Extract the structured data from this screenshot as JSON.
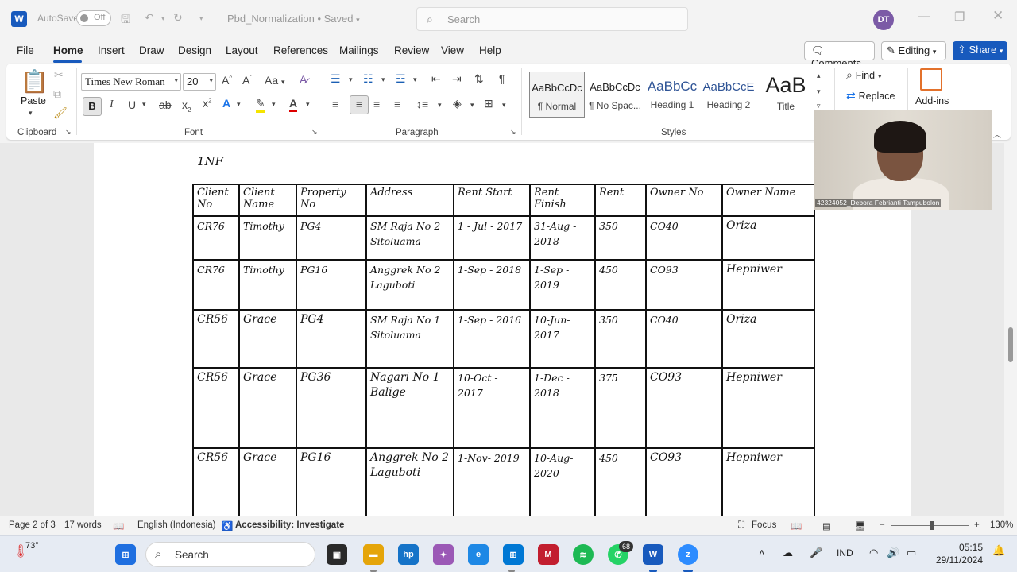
{
  "titlebar": {
    "app_icon": "W",
    "autosave_label": "AutoSave",
    "autosave_state": "Off",
    "doc_name": "Pbd_Normalization • Saved",
    "search_placeholder": "Search",
    "avatar_initials": "DT"
  },
  "menu": {
    "items": [
      "File",
      "Home",
      "Insert",
      "Draw",
      "Design",
      "Layout",
      "References",
      "Mailings",
      "Review",
      "View",
      "Help"
    ],
    "active": "Home",
    "comments": "Comments",
    "editing": "Editing",
    "share": "Share"
  },
  "ribbon": {
    "clipboard": {
      "paste": "Paste",
      "label": "Clipboard"
    },
    "font": {
      "family": "Times New Roman",
      "size": "20",
      "label": "Font",
      "case_label": "Aa"
    },
    "paragraph": {
      "label": "Paragraph"
    },
    "styles": {
      "label": "Styles",
      "items": [
        {
          "preview": "AaBbCcDc",
          "name": "¶ Normal"
        },
        {
          "preview": "AaBbCcDc",
          "name": "¶ No Spac..."
        },
        {
          "preview": "AaBbCc",
          "name": "Heading 1"
        },
        {
          "preview": "AaBbCcE",
          "name": "Heading 2"
        },
        {
          "preview": "AaB",
          "name": "Title"
        }
      ]
    },
    "editing": {
      "find": "Find",
      "replace": "Replace"
    },
    "addins": {
      "label": "Add-ins"
    }
  },
  "document": {
    "heading": "1NF",
    "table": {
      "headers": [
        "Client No",
        "Client Name",
        "Property No",
        "Address",
        "Rent Start",
        "Rent Finish",
        "Rent",
        "Owner No",
        "Owner Name"
      ],
      "rows": [
        [
          "CR76",
          "Timothy",
          "PG4",
          "SM Raja No 2 Sitoluama",
          "1 - Jul - 2017",
          "31-Aug - 2018",
          "350",
          "CO40",
          "Oriza"
        ],
        [
          "CR76",
          "Timothy",
          "PG16",
          "Anggrek No 2 Laguboti",
          "1-Sep - 2018",
          "1-Sep - 2019",
          "450",
          "CO93",
          "Hepniwer"
        ],
        [
          "CR56",
          "Grace",
          "PG4",
          "SM Raja No 1 Sitoluama",
          "1-Sep - 2016",
          "10-Jun-2017",
          "350",
          "CO40",
          "Oriza"
        ],
        [
          "CR56",
          "Grace",
          "PG36",
          "Nagari No 1 Balige",
          "10-Oct - 2017",
          "1-Dec - 2018",
          "375",
          "CO93",
          "Hepniwer"
        ],
        [
          "CR56",
          "Grace",
          "PG16",
          "Anggrek No 2 Laguboti",
          "1-Nov- 2019",
          "10-Aug- 2020",
          "450",
          "CO93",
          "Hepniwer"
        ]
      ]
    }
  },
  "video": {
    "caption": "42324052_Debora Febrianti Tampubolon"
  },
  "status": {
    "page": "Page 2 of 3",
    "words": "17 words",
    "language": "English (Indonesia)",
    "accessibility": "Accessibility: Investigate",
    "focus": "Focus",
    "zoom": "130%"
  },
  "taskbar": {
    "weather": "73°",
    "search_placeholder": "Search",
    "whatsapp_badge": "68",
    "lang": "IND",
    "time": "05:15",
    "date": "29/11/2024"
  },
  "colors": {
    "accent": "#185abd",
    "word_blue": "#185abd",
    "avatar": "#7b5aa6"
  }
}
